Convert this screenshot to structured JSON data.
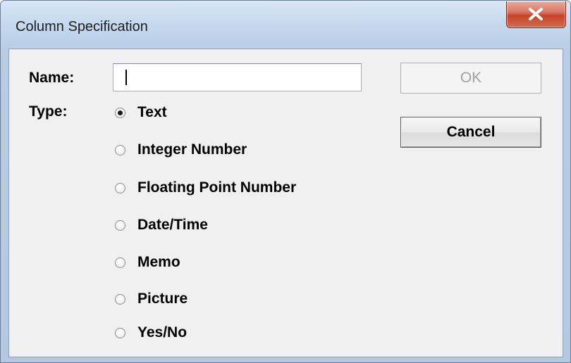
{
  "window": {
    "title": "Column Specification"
  },
  "form": {
    "name_label": "Name:",
    "name_value": "",
    "type_label": "Type:",
    "type_options": [
      {
        "label": "Text",
        "checked": true
      },
      {
        "label": "Integer Number",
        "checked": false
      },
      {
        "label": "Floating Point Number",
        "checked": false
      },
      {
        "label": "Date/Time",
        "checked": false
      },
      {
        "label": "Memo",
        "checked": false
      },
      {
        "label": "Picture",
        "checked": false
      },
      {
        "label": "Yes/No",
        "checked": false
      }
    ]
  },
  "buttons": {
    "ok_label": "OK",
    "ok_disabled": true,
    "cancel_label": "Cancel"
  },
  "icons": {
    "close": "close-icon",
    "radio": "radio-button-icon"
  }
}
